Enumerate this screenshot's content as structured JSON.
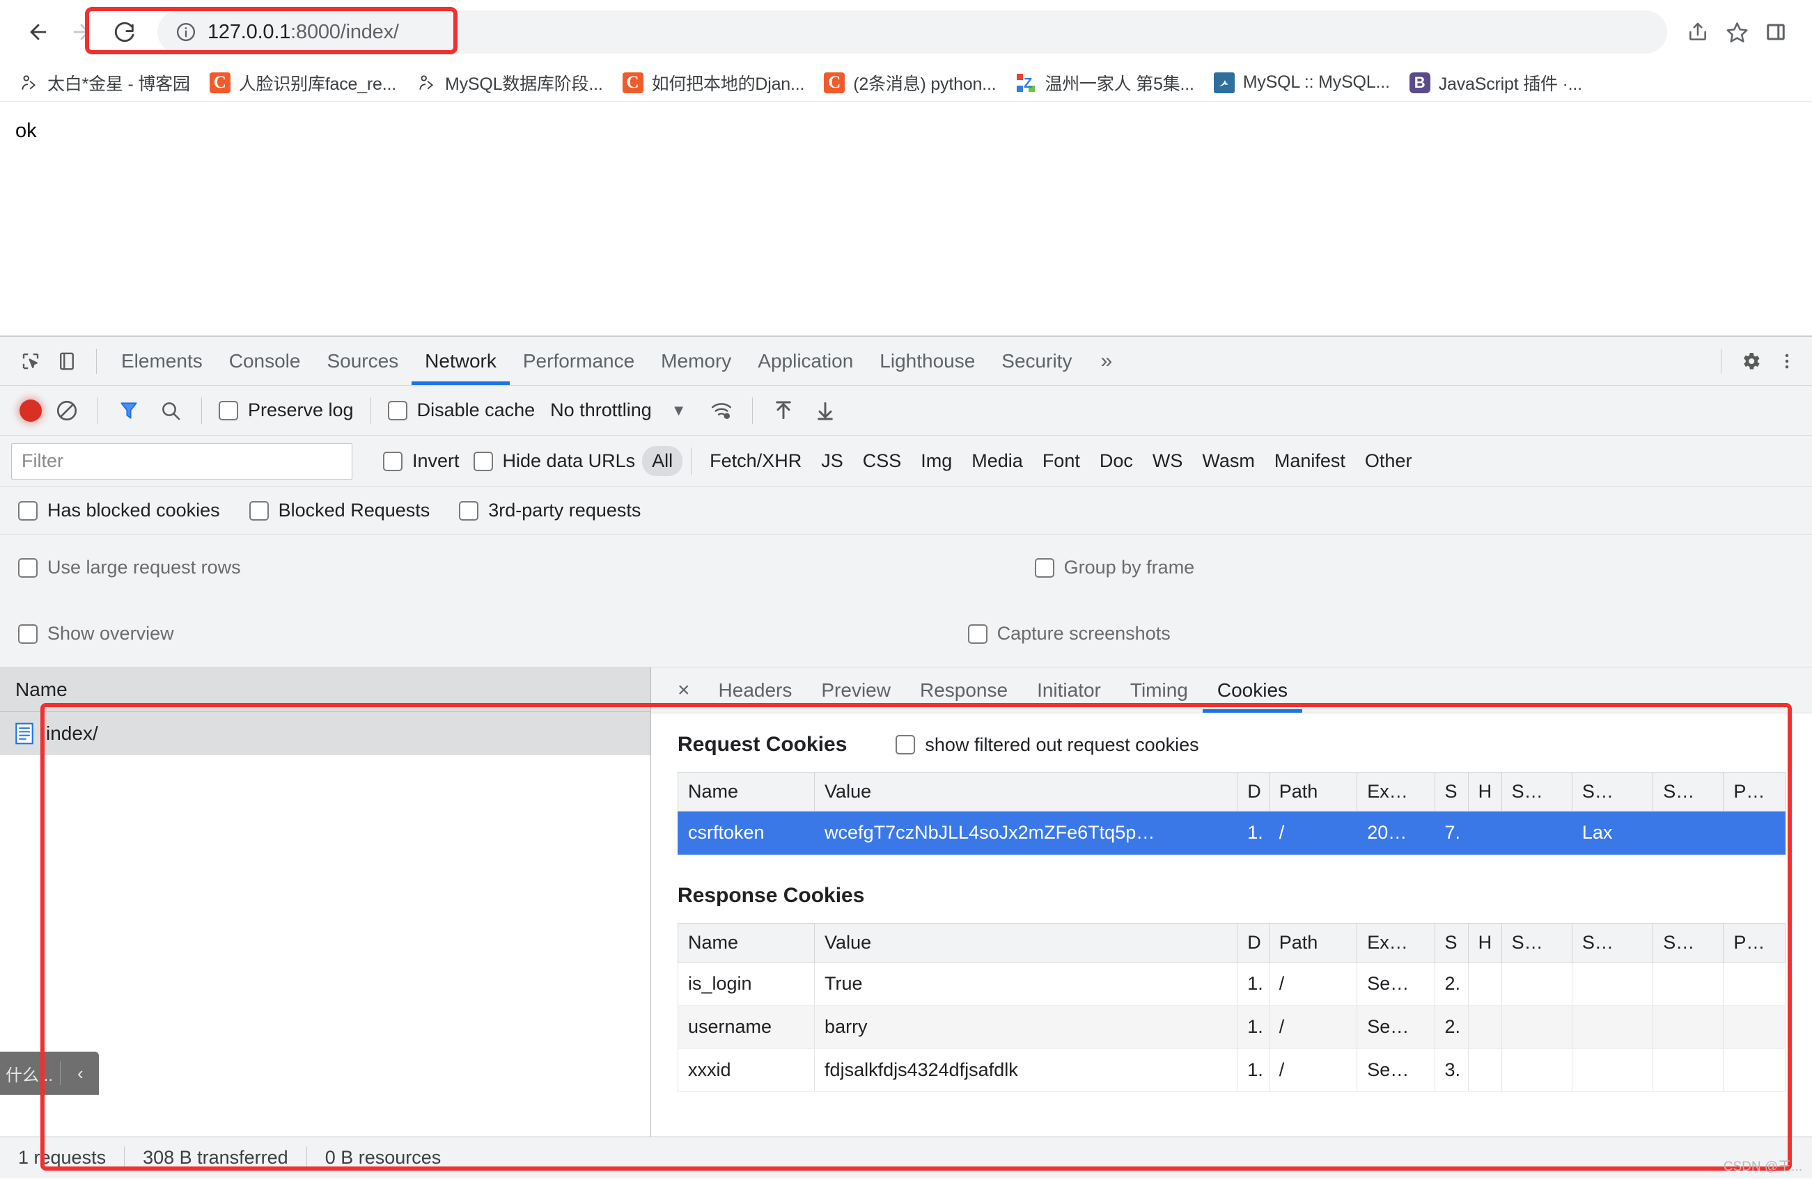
{
  "browser": {
    "url_host": "127.0.0.1",
    "url_path": ":8000/index/",
    "back_icon": "back-arrow-icon",
    "forward_icon": "forward-arrow-icon",
    "reload_icon": "reload-icon",
    "info_icon": "page-info-icon",
    "share_icon": "share-icon",
    "bookmark_icon": "star-icon",
    "sidepanel_icon": "side-panel-icon",
    "bookmarks": [
      {
        "label": "太白*金星 - 博客园",
        "favicon": "person-icon"
      },
      {
        "label": "人脸识别库face_re...",
        "favicon": "csdn-icon"
      },
      {
        "label": "MySQL数据库阶段...",
        "favicon": "person-icon"
      },
      {
        "label": "如何把本地的Djan...",
        "favicon": "csdn-icon"
      },
      {
        "label": "(2条消息) python...",
        "favicon": "csdn-icon"
      },
      {
        "label": "温州一家人 第5集...",
        "favicon": "zhihu-icon"
      },
      {
        "label": "MySQL :: MySQL...",
        "favicon": "mysql-dolphin-icon"
      },
      {
        "label": "JavaScript 插件 ·...",
        "favicon": "bootstrap-icon"
      }
    ]
  },
  "page": {
    "body_text": "ok"
  },
  "devtools": {
    "inspect_icon": "inspect-element-icon",
    "device_icon": "device-toolbar-icon",
    "settings_icon": "gear-icon",
    "menu_icon": "more-vertical-icon",
    "more_tabs_label": "»",
    "tabs": [
      {
        "label": "Elements",
        "active": false
      },
      {
        "label": "Console",
        "active": false
      },
      {
        "label": "Sources",
        "active": false
      },
      {
        "label": "Network",
        "active": true
      },
      {
        "label": "Performance",
        "active": false
      },
      {
        "label": "Memory",
        "active": false
      },
      {
        "label": "Application",
        "active": false
      },
      {
        "label": "Lighthouse",
        "active": false
      },
      {
        "label": "Security",
        "active": false
      }
    ],
    "network_toolbar": {
      "record_icon": "record-stop-icon",
      "clear_icon": "clear-icon",
      "filter_icon": "filter-funnel-icon",
      "search_icon": "search-icon",
      "preserve_log_label": "Preserve log",
      "preserve_log_checked": false,
      "disable_cache_label": "Disable cache",
      "disable_cache_checked": false,
      "throttling_value": "No throttling",
      "throttling_caret": "▼",
      "network_conditions_icon": "wifi-settings-icon",
      "import_har_icon": "upload-arrow-icon",
      "export_har_icon": "download-arrow-icon"
    },
    "filter_row": {
      "filter_placeholder": "Filter",
      "filter_value": "",
      "invert_label": "Invert",
      "invert_checked": false,
      "hide_data_urls_label": "Hide data URLs",
      "hide_data_urls_checked": false,
      "types": [
        {
          "label": "All",
          "selected": true
        },
        {
          "label": "Fetch/XHR",
          "selected": false
        },
        {
          "label": "JS",
          "selected": false
        },
        {
          "label": "CSS",
          "selected": false
        },
        {
          "label": "Img",
          "selected": false
        },
        {
          "label": "Media",
          "selected": false
        },
        {
          "label": "Font",
          "selected": false
        },
        {
          "label": "Doc",
          "selected": false
        },
        {
          "label": "WS",
          "selected": false
        },
        {
          "label": "Wasm",
          "selected": false
        },
        {
          "label": "Manifest",
          "selected": false
        },
        {
          "label": "Other",
          "selected": false
        }
      ]
    },
    "options_row": {
      "has_blocked_cookies_label": "Has blocked cookies",
      "has_blocked_cookies_checked": false,
      "blocked_requests_label": "Blocked Requests",
      "blocked_requests_checked": false,
      "third_party_label": "3rd-party requests",
      "third_party_checked": false
    },
    "settings_rows": {
      "use_large_rows_label": "Use large request rows",
      "use_large_rows_checked": false,
      "group_by_frame_label": "Group by frame",
      "group_by_frame_checked": false,
      "show_overview_label": "Show overview",
      "show_overview_checked": false,
      "capture_screenshots_label": "Capture screenshots",
      "capture_screenshots_checked": false
    },
    "request_list": {
      "column_header": "Name",
      "rows": [
        {
          "name": "index/",
          "icon": "document-icon",
          "selected": true
        }
      ]
    },
    "status_bar": {
      "requests": "1 requests",
      "transferred": "308 B transferred",
      "resources": "0 B resources"
    },
    "dark_chip": {
      "label": "什么...",
      "collapse_icon": "chevron-left-icon"
    },
    "detail": {
      "close_label": "×",
      "tabs": [
        {
          "label": "Headers",
          "active": false
        },
        {
          "label": "Preview",
          "active": false
        },
        {
          "label": "Response",
          "active": false
        },
        {
          "label": "Initiator",
          "active": false
        },
        {
          "label": "Timing",
          "active": false
        },
        {
          "label": "Cookies",
          "active": true
        }
      ],
      "request_cookies": {
        "title": "Request Cookies",
        "show_filtered_label": "show filtered out request cookies",
        "show_filtered_checked": false,
        "columns": [
          "Name",
          "Value",
          "D",
          "Path",
          "Ex…",
          "S",
          "H",
          "S…",
          "S…",
          "S…",
          "P…"
        ],
        "rows": [
          {
            "selected": true,
            "cells": [
              "csrftoken",
              "wcefgT7czNbJLL4soJx2mZFe6Ttq5p…",
              "1.",
              "/",
              "20…",
              "7.",
              "",
              "",
              "Lax",
              "",
              ""
            ]
          }
        ]
      },
      "response_cookies": {
        "title": "Response Cookies",
        "columns": [
          "Name",
          "Value",
          "D",
          "Path",
          "Ex…",
          "S",
          "H",
          "S…",
          "S…",
          "S…",
          "P…"
        ],
        "rows": [
          {
            "selected": false,
            "cells": [
              "is_login",
              "True",
              "1.",
              "/",
              "Se…",
              "2.",
              "",
              "",
              "",
              "",
              ""
            ]
          },
          {
            "selected": false,
            "cells": [
              "username",
              "barry",
              "1.",
              "/",
              "Se…",
              "2.",
              "",
              "",
              "",
              "",
              ""
            ]
          },
          {
            "selected": false,
            "cells": [
              "xxxid",
              "fdjsalkfdjs4324dfjsafdlk",
              "1.",
              "/",
              "Se…",
              "3.",
              "",
              "",
              "",
              "",
              ""
            ]
          }
        ]
      }
    }
  },
  "watermark": "CSDN @王...",
  "colors": {
    "accent_blue": "#1a73e8",
    "selection_blue": "#3b78e7",
    "annotation_red": "#f2302f",
    "record_red": "#d93025"
  }
}
